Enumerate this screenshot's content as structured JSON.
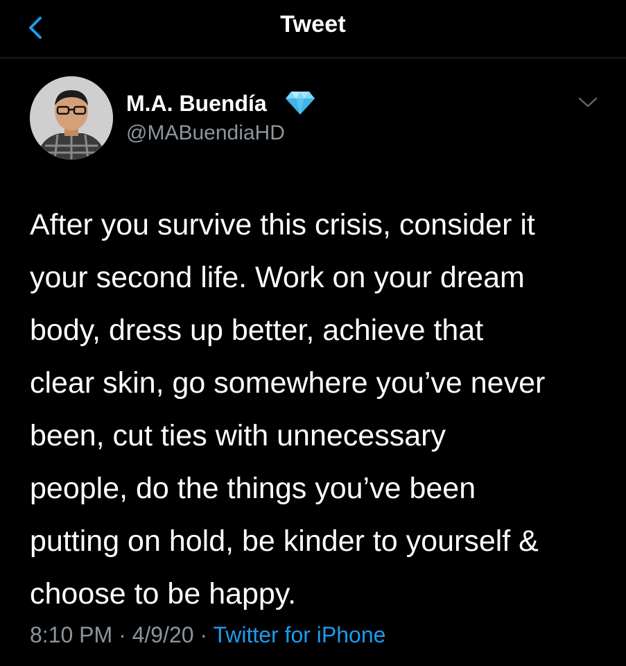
{
  "header": {
    "title": "Tweet",
    "back_icon": "chevron-left-icon",
    "accent_color": "#1d9bf0"
  },
  "author": {
    "name": "M.A. Buendía",
    "handle": "@MABuendiaHD",
    "badge_icon": "diamond-icon",
    "badge_color": "#5ec8f2"
  },
  "tweet": {
    "lines": [
      "After you survive this crisis, consider it",
      "your second life. Work on your dream",
      "body, dress up better, achieve that",
      "clear skin, go somewhere you’ve never",
      "been, cut ties with unnecessary",
      "people, do the things you’ve been",
      "putting on hold, be kinder to yourself &",
      "choose to be happy."
    ]
  },
  "meta": {
    "time": "8:10 PM",
    "sep1": " · ",
    "date": "4/9/20",
    "sep2": " · ",
    "source": "Twitter for iPhone"
  },
  "theme": {
    "background": "#000000",
    "text": "#ffffff",
    "muted": "#8e959c",
    "divider": "#2f3336"
  }
}
